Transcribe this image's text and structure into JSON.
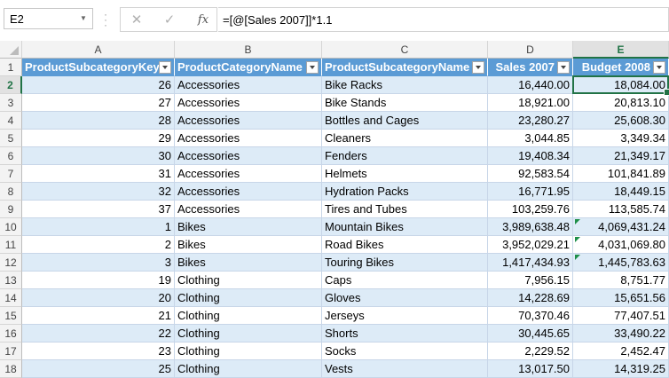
{
  "formula_bar": {
    "name_box": "E2",
    "cancel_icon": "✕",
    "enter_icon": "✓",
    "fx_label": "fx",
    "formula": "=[@[Sales 2007]]*1.1"
  },
  "columns": [
    "A",
    "B",
    "C",
    "D",
    "E"
  ],
  "active_column": "E",
  "active_row": "2",
  "table": {
    "headers": [
      "ProductSubcategoryKey",
      "ProductCategoryName",
      "ProductSubcategoryName",
      "Sales 2007",
      "Budget 2008"
    ],
    "rows": [
      {
        "n": "2",
        "key": "26",
        "cat": "Accessories",
        "sub": "Bike Racks",
        "sales": "16,440.00",
        "budget": "18,084.00"
      },
      {
        "n": "3",
        "key": "27",
        "cat": "Accessories",
        "sub": "Bike Stands",
        "sales": "18,921.00",
        "budget": "20,813.10"
      },
      {
        "n": "4",
        "key": "28",
        "cat": "Accessories",
        "sub": "Bottles and Cages",
        "sales": "23,280.27",
        "budget": "25,608.30"
      },
      {
        "n": "5",
        "key": "29",
        "cat": "Accessories",
        "sub": "Cleaners",
        "sales": "3,044.85",
        "budget": "3,349.34"
      },
      {
        "n": "6",
        "key": "30",
        "cat": "Accessories",
        "sub": "Fenders",
        "sales": "19,408.34",
        "budget": "21,349.17"
      },
      {
        "n": "7",
        "key": "31",
        "cat": "Accessories",
        "sub": "Helmets",
        "sales": "92,583.54",
        "budget": "101,841.89"
      },
      {
        "n": "8",
        "key": "32",
        "cat": "Accessories",
        "sub": "Hydration Packs",
        "sales": "16,771.95",
        "budget": "18,449.15"
      },
      {
        "n": "9",
        "key": "37",
        "cat": "Accessories",
        "sub": "Tires and Tubes",
        "sales": "103,259.76",
        "budget": "113,585.74"
      },
      {
        "n": "10",
        "key": "1",
        "cat": "Bikes",
        "sub": "Mountain Bikes",
        "sales": "3,989,638.48",
        "budget": "4,069,431.24"
      },
      {
        "n": "11",
        "key": "2",
        "cat": "Bikes",
        "sub": "Road Bikes",
        "sales": "3,952,029.21",
        "budget": "4,031,069.80"
      },
      {
        "n": "12",
        "key": "3",
        "cat": "Bikes",
        "sub": "Touring Bikes",
        "sales": "1,417,434.93",
        "budget": "1,445,783.63"
      },
      {
        "n": "13",
        "key": "19",
        "cat": "Clothing",
        "sub": "Caps",
        "sales": "7,956.15",
        "budget": "8,751.77"
      },
      {
        "n": "14",
        "key": "20",
        "cat": "Clothing",
        "sub": "Gloves",
        "sales": "14,228.69",
        "budget": "15,651.56"
      },
      {
        "n": "15",
        "key": "21",
        "cat": "Clothing",
        "sub": "Jerseys",
        "sales": "70,370.46",
        "budget": "77,407.51"
      },
      {
        "n": "16",
        "key": "22",
        "cat": "Clothing",
        "sub": "Shorts",
        "sales": "30,445.65",
        "budget": "33,490.22"
      },
      {
        "n": "17",
        "key": "23",
        "cat": "Clothing",
        "sub": "Socks",
        "sales": "2,229.52",
        "budget": "2,452.47"
      },
      {
        "n": "18",
        "key": "25",
        "cat": "Clothing",
        "sub": "Vests",
        "sales": "13,017.50",
        "budget": "14,319.25"
      }
    ]
  },
  "header_row_number": "1",
  "colors": {
    "header_fill": "#5b9bd5",
    "band_fill": "#ddebf7",
    "selection": "#217346",
    "error_indicator": "#1e8f49"
  }
}
